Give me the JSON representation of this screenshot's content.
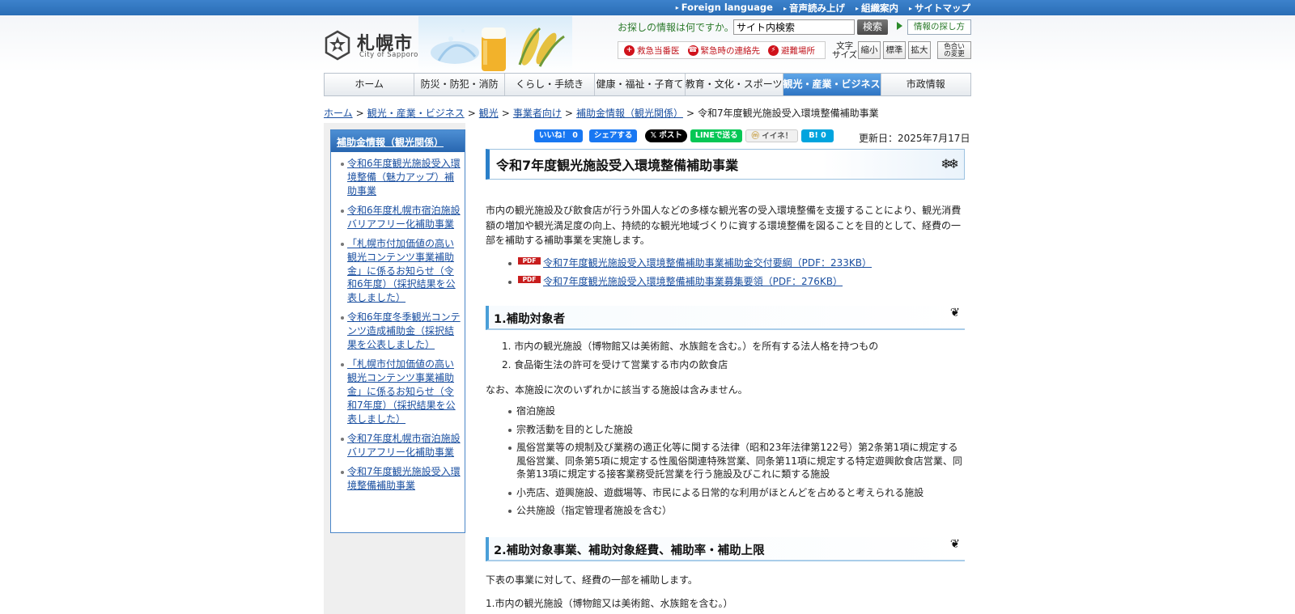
{
  "topbar": {
    "links": [
      "Foreign language",
      "音声読み上げ",
      "組織案内",
      "サイトマップ"
    ]
  },
  "logo": {
    "name": "札幌市",
    "en": "City of Sapporo"
  },
  "search": {
    "label": "お探しの情報は何ですか。",
    "value": "サイト内検索",
    "button": "検索",
    "find_guide": "情報の探し方"
  },
  "emergency": {
    "items": [
      {
        "label": "救急当番医",
        "icon": "medical-icon"
      },
      {
        "label": "緊急時の連絡先",
        "icon": "phone-icon"
      },
      {
        "label": "避難場所",
        "icon": "shelter-icon"
      }
    ]
  },
  "font_size": {
    "label_top": "文字",
    "label_bottom": "サイズ",
    "shrink": "縮小",
    "standard": "標準",
    "enlarge": "拡大",
    "color_top": "色合い",
    "color_bottom": "の変更"
  },
  "gnav": {
    "items": [
      "ホーム",
      "防災・防犯・消防",
      "くらし・手続き",
      "健康・福祉・子育て",
      "教育・文化・スポーツ",
      "観光・産業・ビジネス",
      "市政情報"
    ],
    "active_index": 5
  },
  "breadcrumb": {
    "links": [
      "ホーム",
      "観光・産業・ビジネス",
      "観光",
      "事業者向け",
      "補助金情報（観光関係）"
    ],
    "current": "令和7年度観光施設受入環境整備補助事業",
    "separator": ">"
  },
  "sidebar": {
    "heading": "補助金情報（観光関係）",
    "items": [
      "令和6年度観光施設受入環境整備（魅力アップ）補助事業",
      "令和6年度札幌市宿泊施設バリアフリー化補助事業",
      "「札幌市付加価値の高い観光コンテンツ事業補助金」に係るお知らせ（令和6年度）（採択結果を公表しました）",
      "令和6年度冬季観光コンテンツ造成補助金（採択結果を公表しました）",
      "「札幌市付加価値の高い観光コンテンツ事業補助金」に係るお知らせ（令和7年度）（採択結果を公表しました）",
      "令和7年度札幌市宿泊施設バリアフリー化補助事業",
      "令和7年度観光施設受入環境整備補助事業"
    ]
  },
  "social": {
    "fb_like": "いいね！ 0",
    "fb_share": "シェアする",
    "x_post": "ポスト",
    "line": "LINEで送る",
    "mixi": "イイネ！",
    "hatena": "B! 0"
  },
  "updated": "更新日：2025年7月17日",
  "main": {
    "title": "令和7年度観光施設受入環境整備補助事業",
    "intro": "市内の観光施設及び飲食店が行う外国人などの多様な観光客の受入環境整備を支援することにより、観光消費額の増加や観光満足度の向上、持続的な観光地域づくりに資する環境整備を図ることを目的として、経費の一部を補助する補助事業を実施します。",
    "pdf_label": "PDF",
    "pdfs": [
      "令和7年度観光施設受入環境整備補助事業補助金交付要綱（PDF：233KB）",
      "令和7年度観光施設受入環境整備補助事業募集要領（PDF：276KB）"
    ],
    "section1": {
      "heading": "1.補助対象者",
      "items": [
        "1. 市内の観光施設（博物館又は美術館、水族館を含む。）を所有する法人格を持つもの",
        "2. 食品衛生法の許可を受けて営業する市内の飲食店"
      ],
      "note": "なお、本施設に次のいずれかに該当する施設は含みません。",
      "excluded": [
        "宿泊施設",
        "宗教活動を目的とした施設",
        "風俗営業等の規制及び業務の適正化等に関する法律（昭和23年法律第122号）第2条第1項に規定する風俗営業、同条第5項に規定する性風俗関連特殊営業、同条第11項に規定する特定遊興飲食店営業、同条第13項に規定する接客業務受託営業を行う施設及びこれに類する施設",
        "小売店、遊興施設、遊戯場等、市民による日常的な利用がほとんどを占めると考えられる施設",
        "公共施設（指定管理者施設を含む）"
      ]
    },
    "section2": {
      "heading": "2.補助対象事業、補助対象経費、補助率・補助上限",
      "intro": "下表の事業に対して、経費の一部を補助します。",
      "sub": "1.市内の観光施設（博物館又は美術館、水族館を含む。）"
    }
  },
  "colors": {
    "topbar": "#2a6db5",
    "nav_active": "#2f75c4",
    "link": "#1a4fa0",
    "emergency": "#d0121b",
    "search_label": "#2b7a2b"
  }
}
